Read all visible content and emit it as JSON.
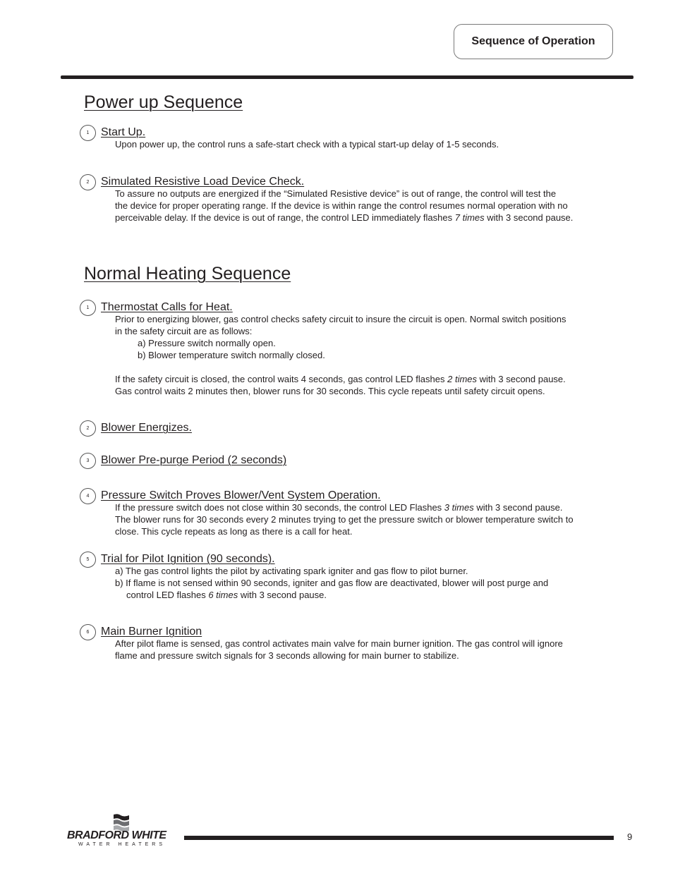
{
  "header": {
    "section_label": "Sequence of Operation"
  },
  "power_up": {
    "title": "Power up Sequence",
    "steps": [
      {
        "number": "1",
        "title": "Start Up.",
        "body": [
          "Upon power up, the control runs a safe-start check with a typical start-up delay of 1-5 seconds."
        ]
      },
      {
        "number": "2",
        "title": "Simulated Resistive Load Device Check.",
        "body_lines": [
          "To assure no outputs are energized if the “Simulated Resistive device” is out of range, the control will test the",
          "the device for proper operating range. If the device is within range the control resumes normal operation with no"
        ],
        "body_last_pre": "perceivable delay. If the device is out of range, the control LED immediately flashes ",
        "body_last_em": "7 times",
        "body_last_post": " with 3 second pause."
      }
    ]
  },
  "normal_heating": {
    "title": "Normal Heating Sequence",
    "steps": [
      {
        "number": "1",
        "title": "Thermostat Calls for Heat.",
        "intro_lines": [
          "Prior to energizing blower, gas control checks safety circuit to insure the circuit is open. Normal switch positions",
          "in the safety circuit are as follows:"
        ],
        "list": [
          "a) Pressure switch normally open.",
          "b) Blower temperature switch normally closed."
        ],
        "para2_pre": "If the safety circuit is closed, the control waits 4 seconds, gas control LED flashes ",
        "para2_em": "2 times",
        "para2_post": " with 3 second pause.",
        "para2_line2": "Gas control waits 2 minutes then, blower runs for 30 seconds. This cycle repeats until safety circuit opens."
      },
      {
        "number": "2",
        "title": "Blower Energizes."
      },
      {
        "number": "3",
        "title": "Blower Pre-purge Period (2 seconds)"
      },
      {
        "number": "4",
        "title": "Pressure Switch Proves Blower/Vent System Operation.",
        "line1_pre": "If the pressure switch does not close within 30 seconds, the control LED Flashes ",
        "line1_em": "3 times",
        "line1_post": " with 3 second pause.",
        "line2": "The blower runs for 30 seconds every 2 minutes trying to get the pressure switch or blower temperature switch to",
        "line3": "close. This cycle repeats as long as there is a call for heat."
      },
      {
        "number": "5",
        "title": "Trial for Pilot Ignition (90 seconds).",
        "item_a": "a) The gas control lights the pilot by activating spark igniter and gas flow to pilot burner.",
        "item_b_line1": "b) If flame is not sensed within 90 seconds, igniter and gas flow are deactivated, blower will post purge and",
        "item_b_line2_pre": "control LED flashes ",
        "item_b_line2_em": "6 times",
        "item_b_line2_post": " with 3 second pause."
      },
      {
        "number": "6",
        "title": "Main Burner Ignition",
        "line1": "After pilot flame is sensed, gas control activates main valve for main burner ignition. The gas control will ignore",
        "line2": "flame and pressure switch signals for 3 seconds allowing for main burner to stabilize."
      }
    ]
  },
  "footer": {
    "brand": "BRADFORD WHITE",
    "brand_sub": "WATER HEATERS",
    "page_number": "9"
  }
}
